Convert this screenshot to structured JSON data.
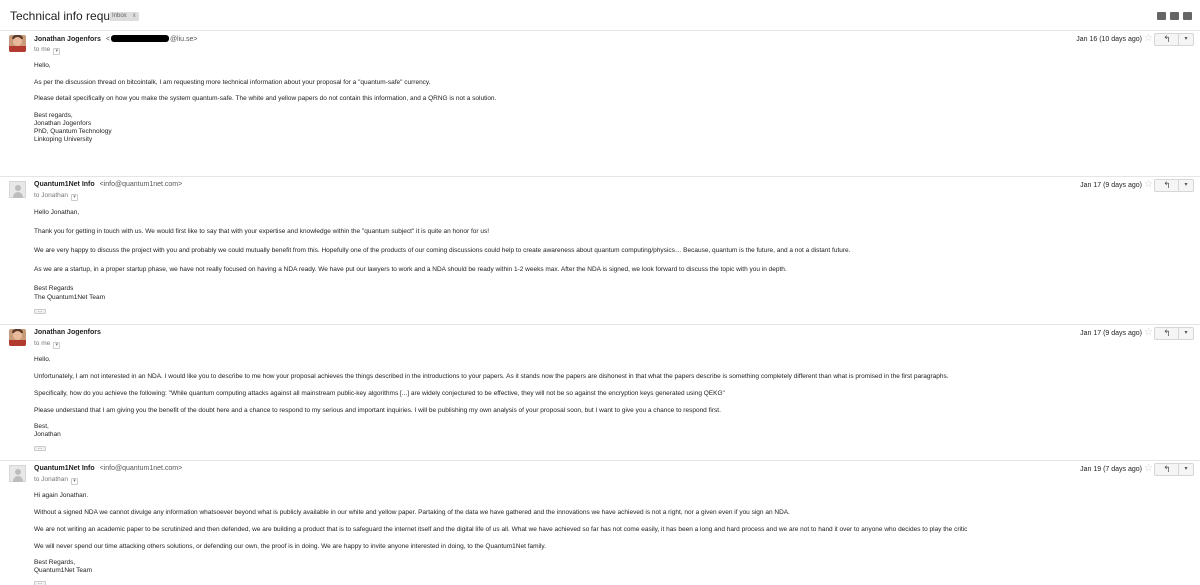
{
  "thread": {
    "subject": "Technical info request",
    "label": "Inbox",
    "label_close": "x",
    "icons": [
      "print-icon",
      "print-all-icon",
      "new-window-icon"
    ]
  },
  "messages": [
    {
      "sender_name": "Jonathan Jogenfors",
      "email_prefix": "<",
      "email_suffix": "@liu.se>",
      "to": "to me",
      "date": "Jan 16 (10 days ago)",
      "avatar": "photo",
      "lines": [
        "Hello,",
        "As per the discussion thread on bitcointalk, I am requesting more technical information about your proposal for a \"quantum-safe\" currency.",
        "Please detail specifically on how you make the system quantum-safe. The white and yellow papers do not contain this information, and a QRNG is not a solution.",
        "Best regards,",
        "Jonathan Jogenfors",
        "PhD, Quantum Technology",
        "Linkoping University"
      ]
    },
    {
      "sender_name": "Quantum1Net Info",
      "email": "<info@quantum1net.com>",
      "to": "to Jonathan",
      "date": "Jan 17 (9 days ago)",
      "avatar": "generic",
      "lines": [
        "Hello Jonathan,",
        "Thank you for getting in touch with us. We would first like to say that with your expertise and knowledge within the \"quantum subject\" it is quite an honor for us!",
        "We are very happy to discuss the project with you and probably we could mutually benefit from this. Hopefully one of the products of our coming discussions could help to create awareness about quantum computing/physics… Because, quantum is the future, and a not a distant future.",
        "As we are a startup, in a proper startup phase, we have not really focused on having a NDA ready. We have put our lawyers to work and a NDA should be ready within 1-2 weeks max. After the NDA is signed, we look forward to discuss the topic with you in depth.",
        "Best Regards",
        "The Quantum1Net Team"
      ],
      "ellipsis": "…"
    },
    {
      "sender_name": "Jonathan Jogenfors",
      "to": "to me",
      "date": "Jan 17 (9 days ago)",
      "avatar": "photo",
      "lines": [
        "Hello.",
        "Unfortunately, I am not interested in an NDA. I would like you to describe to me how your proposal achieves the things described in the introductions to your papers. As it stands now the papers are dishonest in that what the papers describe is something completely different than what is promised in the first paragraphs.",
        "Specifically, how do you achieve the following: \"While quantum computing attacks against all mainstream public-key algorithms [...] are widely conjectured to be effective, they will not be so against the encryption keys generated using QEKG\"",
        "Please understand that I am giving you the benefit of the doubt here and a chance to respond to my serious and important inquiries. I will be publishing my own analysis of your proposal soon, but I want to give you a chance to respond first.",
        "Best,",
        "Jonathan"
      ],
      "ellipsis": "…"
    },
    {
      "sender_name": "Quantum1Net Info",
      "email": "<info@quantum1net.com>",
      "to": "to Jonathan",
      "date": "Jan 19 (7 days ago)",
      "avatar": "generic",
      "lines": [
        "Hi again Jonathan.",
        "Without a signed NDA we cannot divulge any information whatsoever beyond what is publicly available in our white and yellow paper. Partaking of the data we have gathered and the innovations we have achieved is not a right, nor a given even if you sign an NDA.",
        "We are not writing an academic paper to be scrutinized and then defended, we are building a product that is to safeguard the internet itself and the digital life of us all. What we have achieved so far has not come easily, it has been a long and hard process and we are not to hand it over to anyone who decides to play the critic",
        "We will never spend our time attacking others solutions, or defending our own, the proof is in doing. We are happy to invite anyone interested in doing, to the Quantum1Net family.",
        "Best Regards,",
        "Quantum1Net Team"
      ],
      "ellipsis": "…"
    }
  ],
  "controls": {
    "star": "☆",
    "reply": "↰",
    "more": "▾",
    "caret": "▾"
  }
}
